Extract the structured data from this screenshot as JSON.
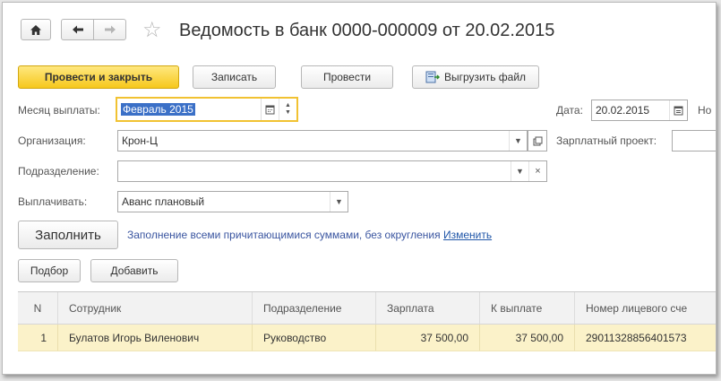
{
  "header": {
    "title": "Ведомость в банк 0000-000009 от 20.02.2015",
    "home_icon": "home-icon",
    "back_icon": "arrow-left-icon",
    "forward_icon": "arrow-right-icon",
    "favorite_icon": "star-icon"
  },
  "toolbar": {
    "post_close_label": "Провести и закрыть",
    "save_label": "Записать",
    "post_label": "Провести",
    "export_label": "Выгрузить файл"
  },
  "form": {
    "month_label": "Месяц выплаты:",
    "month_value": "Февраль 2015",
    "date_label": "Дата:",
    "date_value": "20.02.2015",
    "number_label_partial": "Но",
    "org_label": "Организация:",
    "org_value": "Крон-Ц",
    "salary_project_label": "Зарплатный проект:",
    "dept_label": "Подразделение:",
    "dept_value": "",
    "pay_label": "Выплачивать:",
    "pay_value": "Аванс плановый"
  },
  "fill": {
    "button_label": "Заполнить",
    "info_text": "Заполнение всеми причитающимися суммами, без округления",
    "change_link": "Изменить"
  },
  "table_toolbar": {
    "select_label": "Подбор",
    "add_label": "Добавить"
  },
  "table": {
    "headers": [
      "N",
      "Сотрудник",
      "Подразделение",
      "Зарплата",
      "К выплате",
      "Номер лицевого сче"
    ],
    "rows": [
      [
        "1",
        "Булатов Игорь Виленович",
        "Руководство",
        "37 500,00",
        "37 500,00",
        "29011328856401573"
      ]
    ]
  },
  "colors": {
    "primary_button": "#f6c81c",
    "selected_row": "#fbf2c9",
    "link": "#2056a8",
    "focus_border": "#f1c232"
  }
}
